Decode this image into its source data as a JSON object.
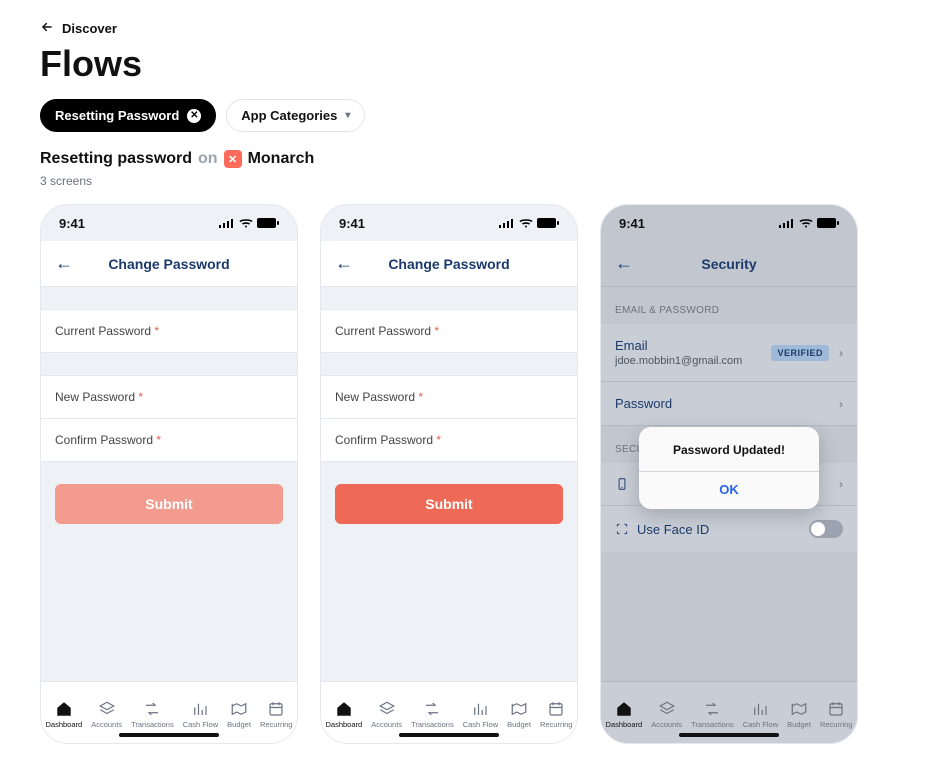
{
  "nav": {
    "back_label": "Discover"
  },
  "title": "Flows",
  "chips": {
    "flow": "Resetting Password",
    "categories": "App Categories"
  },
  "subtitle": {
    "prefix": "Resetting password",
    "on": "on",
    "app_name": "Monarch"
  },
  "screens_count": "3 screens",
  "phone_common": {
    "time": "9:41",
    "tabs": [
      "Dashboard",
      "Accounts",
      "Transactions",
      "Cash Flow",
      "Budget",
      "Recurring"
    ]
  },
  "screen1": {
    "header": "Change Password",
    "fields": {
      "current": "Current Password",
      "new": "New Password",
      "confirm": "Confirm Password"
    },
    "submit": "Submit"
  },
  "screen2": {
    "header": "Change Password",
    "fields": {
      "current": "Current Password",
      "new": "New Password",
      "confirm": "Confirm Password"
    },
    "submit": "Submit"
  },
  "screen3": {
    "header": "Security",
    "section1_label": "EMAIL & PASSWORD",
    "email_label": "Email",
    "email_value": "jdoe.mobbin1@gmail.com",
    "verified": "VERIFIED",
    "password_label": "Password",
    "section2_label": "SECURE",
    "faceid_label": "Use Face ID",
    "modal": {
      "title": "Password Updated!",
      "ok": "OK"
    }
  }
}
